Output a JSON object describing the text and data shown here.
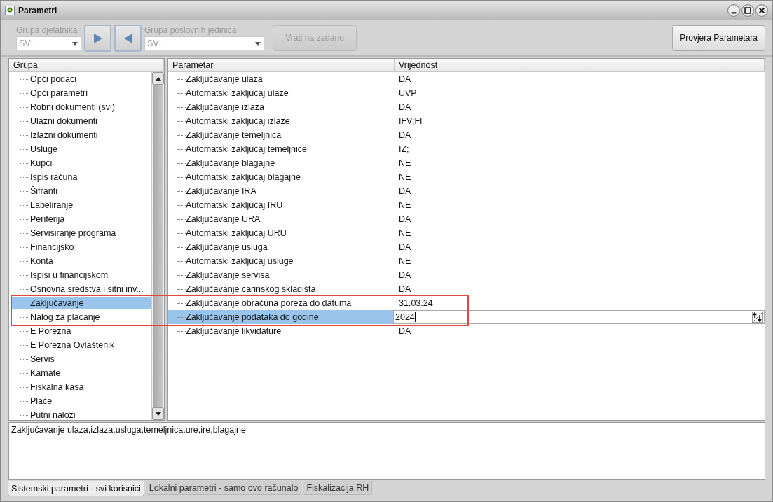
{
  "window": {
    "title": "Parametri"
  },
  "toolbar": {
    "employee_group": {
      "label": "Grupa djelatnika",
      "value": "SVI",
      "disabled": true
    },
    "unit_group": {
      "label": "Grupa poslovnih jedinica",
      "value": "SVI",
      "disabled": true
    },
    "reset_button": {
      "label": "Vrati na zadano",
      "disabled": true
    },
    "check_button": {
      "label": "Provjera Parametara",
      "disabled": false
    }
  },
  "groups": {
    "header": "Grupa",
    "items": [
      {
        "label": "Opći podaci",
        "selected": false
      },
      {
        "label": "Opći parametri",
        "selected": false
      },
      {
        "label": "Robni dokumenti (svi)",
        "selected": false
      },
      {
        "label": "Ulazni dokumenti",
        "selected": false
      },
      {
        "label": "Izlazni dokumenti",
        "selected": false
      },
      {
        "label": "Usluge",
        "selected": false
      },
      {
        "label": "Kupci",
        "selected": false
      },
      {
        "label": "Ispis računa",
        "selected": false
      },
      {
        "label": "Šifranti",
        "selected": false
      },
      {
        "label": "Labeliranje",
        "selected": false
      },
      {
        "label": "Periferija",
        "selected": false
      },
      {
        "label": "Servisiranje programa",
        "selected": false
      },
      {
        "label": "Financijsko",
        "selected": false
      },
      {
        "label": "Konta",
        "selected": false
      },
      {
        "label": "Ispisi u financijskom",
        "selected": false
      },
      {
        "label": "Osnovna sredstva i sitni inv...",
        "selected": false
      },
      {
        "label": "Zaključavanje",
        "selected": true
      },
      {
        "label": "Nalog za plaćanje",
        "selected": false
      },
      {
        "label": "E Porezna",
        "selected": false
      },
      {
        "label": "E Porezna Ovlaštenik",
        "selected": false
      },
      {
        "label": "Servis",
        "selected": false
      },
      {
        "label": "Kamate",
        "selected": false
      },
      {
        "label": "Fiskalna kasa",
        "selected": false
      },
      {
        "label": "Plaće",
        "selected": false
      },
      {
        "label": "Putni nalozi",
        "selected": false
      }
    ]
  },
  "parameters": {
    "columns": [
      "Parametar",
      "Vrijednost"
    ],
    "rows": [
      {
        "name": "Zaključavanje ulaza",
        "value": "DA",
        "selected": false
      },
      {
        "name": "Automatski zaključaj ulaze",
        "value": "UVP",
        "selected": false
      },
      {
        "name": "Zaključavanje izlaza",
        "value": "DA",
        "selected": false
      },
      {
        "name": "Automatski zaključaj izlaze",
        "value": "IFV;FI",
        "selected": false
      },
      {
        "name": "Zaključavanje temeljnica",
        "value": "DA",
        "selected": false
      },
      {
        "name": "Automatski zaključaj temeljnice",
        "value": "IZ;",
        "selected": false
      },
      {
        "name": "Zaključavanje blagajne",
        "value": "NE",
        "selected": false
      },
      {
        "name": "Automatski zaključaj blagajne",
        "value": "NE",
        "selected": false
      },
      {
        "name": "Zaključavanje IRA",
        "value": "DA",
        "selected": false
      },
      {
        "name": "Automatski zaključaj IRU",
        "value": "NE",
        "selected": false
      },
      {
        "name": "Zaključavanje URA",
        "value": "DA",
        "selected": false
      },
      {
        "name": "Automatski zaključaj URU",
        "value": "NE",
        "selected": false
      },
      {
        "name": "Zaključavanje usluga",
        "value": "DA",
        "selected": false
      },
      {
        "name": "Automatski zaključaj usluge",
        "value": "NE",
        "selected": false
      },
      {
        "name": "Zaključavanje servisa",
        "value": "DA",
        "selected": false
      },
      {
        "name": "Zaključavanje carinskog skladišta",
        "value": "DA",
        "selected": false
      },
      {
        "name": "Zaključavanje obračuna poreza do datuma",
        "value": "31.03.24",
        "selected": false
      },
      {
        "name": "Zaključavanje podataka do godine",
        "value": "2024",
        "selected": true
      },
      {
        "name": "Zaključavanje likvidature",
        "value": "DA",
        "selected": false
      }
    ]
  },
  "description": "Zaključavanje ulaza,izlaza,usluga,temeljnica,ure,ire,blagajne",
  "tabs": [
    {
      "label": "Sistemski parametri - svi korisnici",
      "selected": true
    },
    {
      "label": "Lokalni parametri - samo ovo računalo",
      "selected": false
    },
    {
      "label": "Fiskalizacija RH",
      "selected": false
    }
  ]
}
